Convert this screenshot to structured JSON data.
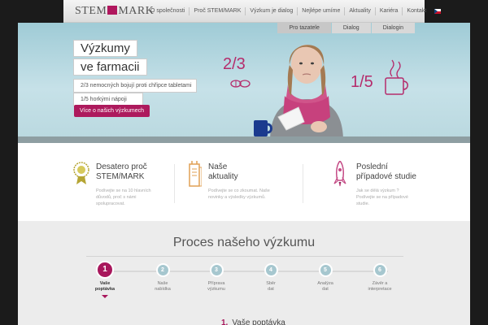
{
  "header": {
    "logo_left": "STEM",
    "logo_right": "MARK",
    "nav": [
      "O společnosti",
      "Proč STEM/MARK",
      "Výzkum je dialog",
      "Nejlépe umíme",
      "Aktuality",
      "Kariéra",
      "Kontakt"
    ],
    "language_flag": "czech-flag-icon"
  },
  "hero": {
    "tabs": [
      "Pro tazatele",
      "Dialog",
      "Dialogin"
    ],
    "title_line1": "Výzkumy",
    "title_line2": "ve farmacii",
    "fact1": "2/3 nemocných bojují proti chřipce tabletami",
    "fact2": "1/5 horkými nápoji",
    "button": "Více o našich výzkumech",
    "stat_left": "2/3",
    "stat_right": "1/5"
  },
  "features": [
    {
      "icon": "badge-icon",
      "title_line1": "Desatero proč",
      "title_line2": "STEM/MARK",
      "text_line1": "Podívejte se na 10 hlavních",
      "text_line2": "důvodů, proč s námi",
      "text_line3": "spolupracovat."
    },
    {
      "icon": "news-icon",
      "title_line1": "Naše",
      "title_line2": "aktuality",
      "text_line1": "Podívejte se co zkoumat. Naše",
      "text_line2": "novinky a výsledky výzkumů.",
      "text_line3": ""
    },
    {
      "icon": "rocket-icon",
      "title_line1": "Poslední",
      "title_line2": "případové studie",
      "text_line1": "Jak se dělá výzkum ?",
      "text_line2": "Podívejte se na případové",
      "text_line3": "studie."
    }
  ],
  "process": {
    "title": "Proces našeho výzkumu",
    "steps": [
      {
        "num": "1",
        "line1": "Vaše",
        "line2": "poptávka"
      },
      {
        "num": "2",
        "line1": "Naše",
        "line2": "nabídka"
      },
      {
        "num": "3",
        "line1": "Příprava",
        "line2": "výzkumu"
      },
      {
        "num": "4",
        "line1": "Sběr",
        "line2": "dat"
      },
      {
        "num": "5",
        "line1": "Analýza",
        "line2": "dat"
      },
      {
        "num": "6",
        "line1": "Závěr a",
        "line2": "interpretace"
      }
    ],
    "active_heading_num": "1.",
    "active_heading": "Vaše poptávka"
  },
  "colors": {
    "accent": "#a8175c",
    "hero_bg": "#b7d8e0",
    "step_inactive": "#a6c7cf"
  }
}
